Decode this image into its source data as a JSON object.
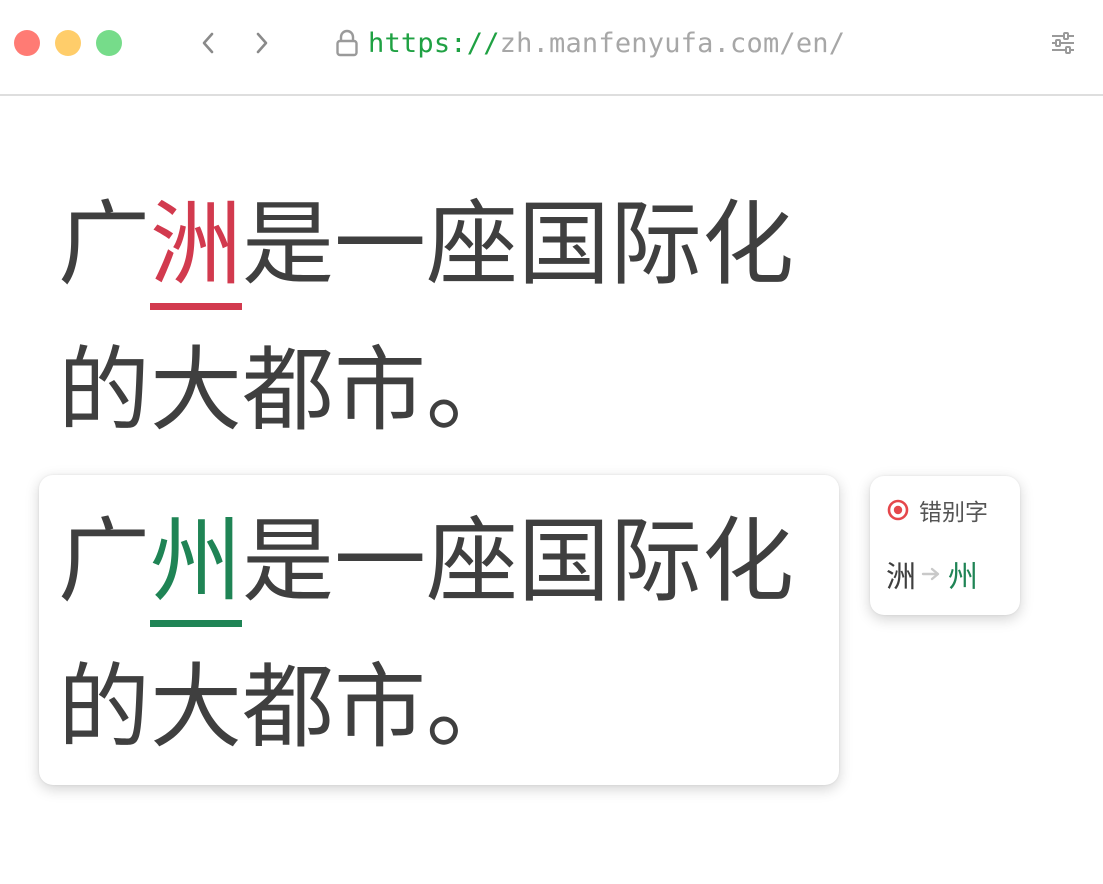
{
  "browser": {
    "url_scheme": "https://",
    "url_host": "zh.manfenyufa.com/en/",
    "icons": {
      "back": "chevron-left-icon",
      "forward": "chevron-right-icon",
      "lock": "lock-icon",
      "settings": "sliders-icon"
    }
  },
  "original_sentence": {
    "line1_before": "广",
    "line1_error": "洲",
    "line1_after": "是一座国际化",
    "line2": "的大都市。"
  },
  "corrected_sentence": {
    "line1_before": "广",
    "line1_fix": "州",
    "line1_after": "是一座国际化",
    "line2": "的大都市。"
  },
  "correction_tip": {
    "category": "错别字",
    "from": "洲",
    "to": "州",
    "icon": "target-icon"
  },
  "colors": {
    "error": "#d23a4e",
    "fix": "#1f8455",
    "url_scheme": "#1fa143",
    "text": "#3f3f3f"
  }
}
